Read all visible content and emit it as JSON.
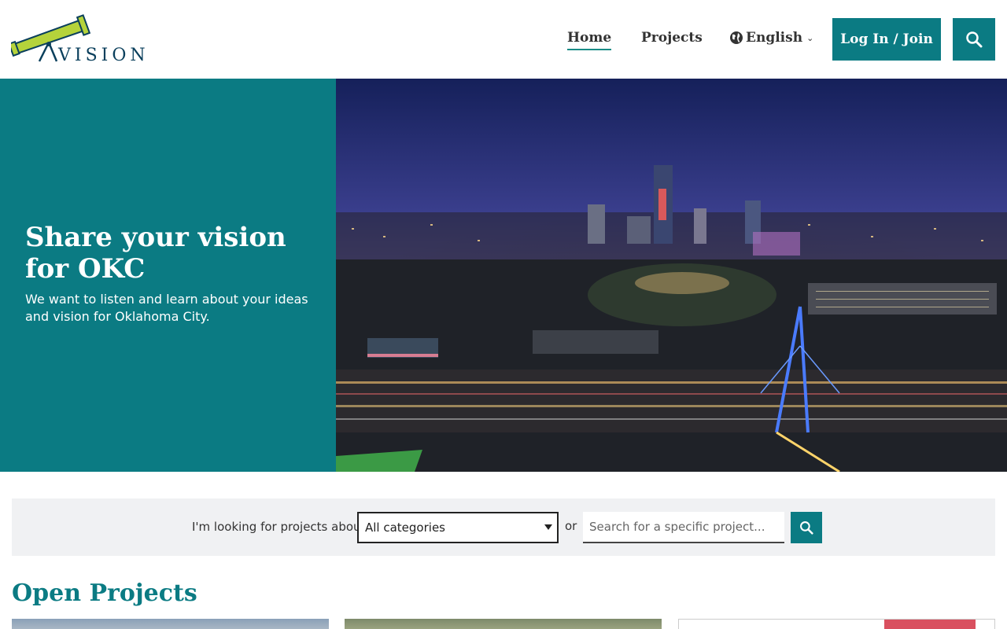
{
  "header": {
    "logo_text": "VISION",
    "nav": {
      "home": "Home",
      "projects": "Projects",
      "language": "English"
    },
    "login_label": "Log In / Join"
  },
  "hero": {
    "title": "Share your vision for OKC",
    "subtitle": "We want to listen and learn about your ideas and vision for Oklahoma City."
  },
  "filter": {
    "label": "I'm looking for projects about",
    "category_selected": "All categories",
    "or_text": "or",
    "search_placeholder": "Search for a specific project..."
  },
  "open_projects": {
    "title": "Open Projects"
  },
  "colors": {
    "accent": "#0b7b83",
    "logo_green": "#b5d33b",
    "logo_navy": "#0a3f5c"
  }
}
